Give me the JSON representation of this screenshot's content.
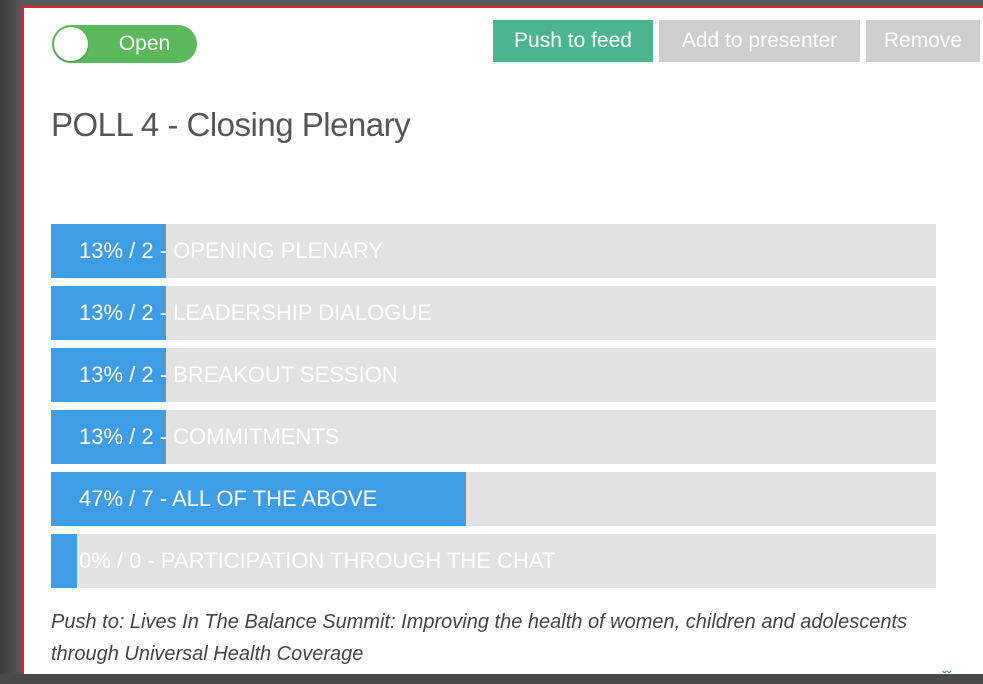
{
  "toggle": {
    "label": "Open",
    "state": "on",
    "color": "#5cb85c"
  },
  "actions": {
    "push_to_feed": "Push to feed",
    "add_to_presenter": "Add to presenter",
    "remove": "Remove"
  },
  "poll": {
    "title": "POLL 4 - Closing Plenary",
    "options": [
      {
        "label": "13% / 2 - OPENING PLENARY",
        "percent": 13,
        "votes": 2
      },
      {
        "label": "13% / 2 - LEADERSHIP DIALOGUE",
        "percent": 13,
        "votes": 2
      },
      {
        "label": "13% / 2 - BREAKOUT SESSION",
        "percent": 13,
        "votes": 2
      },
      {
        "label": "13% / 2 - COMMITMENTS",
        "percent": 13,
        "votes": 2
      },
      {
        "label": "47% / 7 - ALL OF THE ABOVE",
        "percent": 47,
        "votes": 7
      },
      {
        "label": "0% / 0 - PARTICIPATION THROUGH THE CHAT",
        "percent": 0,
        "votes": 0
      }
    ]
  },
  "push_to": "Push to: Lives In The Balance Summit: Improving the health of women, children and adolescents through Universal Health Coverage",
  "colors": {
    "bar_fill": "#3e9de4",
    "bar_track": "#e2e2e2",
    "feed_button": "#4cb58e",
    "disabled_button": "#cfcfcf",
    "frame_border": "#d9262b"
  },
  "icons": {
    "expand": "double-chevron-down-icon"
  }
}
